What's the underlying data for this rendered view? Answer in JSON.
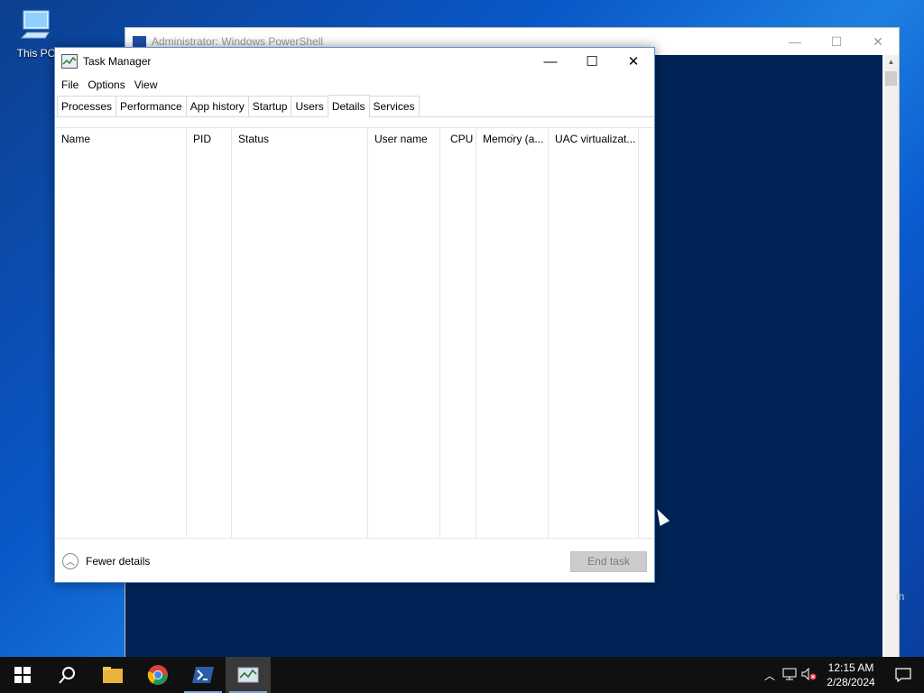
{
  "desktop": {
    "icon_label": "This PC"
  },
  "powershell": {
    "title": "Administrator: Windows PowerShell",
    "partial_text": "in"
  },
  "taskmanager": {
    "title": "Task Manager",
    "menu": [
      "File",
      "Options",
      "View"
    ],
    "tabs": [
      "Processes",
      "Performance",
      "App history",
      "Startup",
      "Users",
      "Details",
      "Services"
    ],
    "active_tab": "Details",
    "columns": [
      "Name",
      "PID",
      "Status",
      "User name",
      "CPU",
      "Memory (a...",
      "UAC virtualizat..."
    ],
    "fewer_details": "Fewer details",
    "end_task": "End task"
  },
  "taskbar": {
    "time": "12:15 AM",
    "date": "2/28/2024",
    "apps": [
      "start-button",
      "search-button",
      "file-explorer",
      "chrome",
      "powershell",
      "task-manager"
    ]
  }
}
